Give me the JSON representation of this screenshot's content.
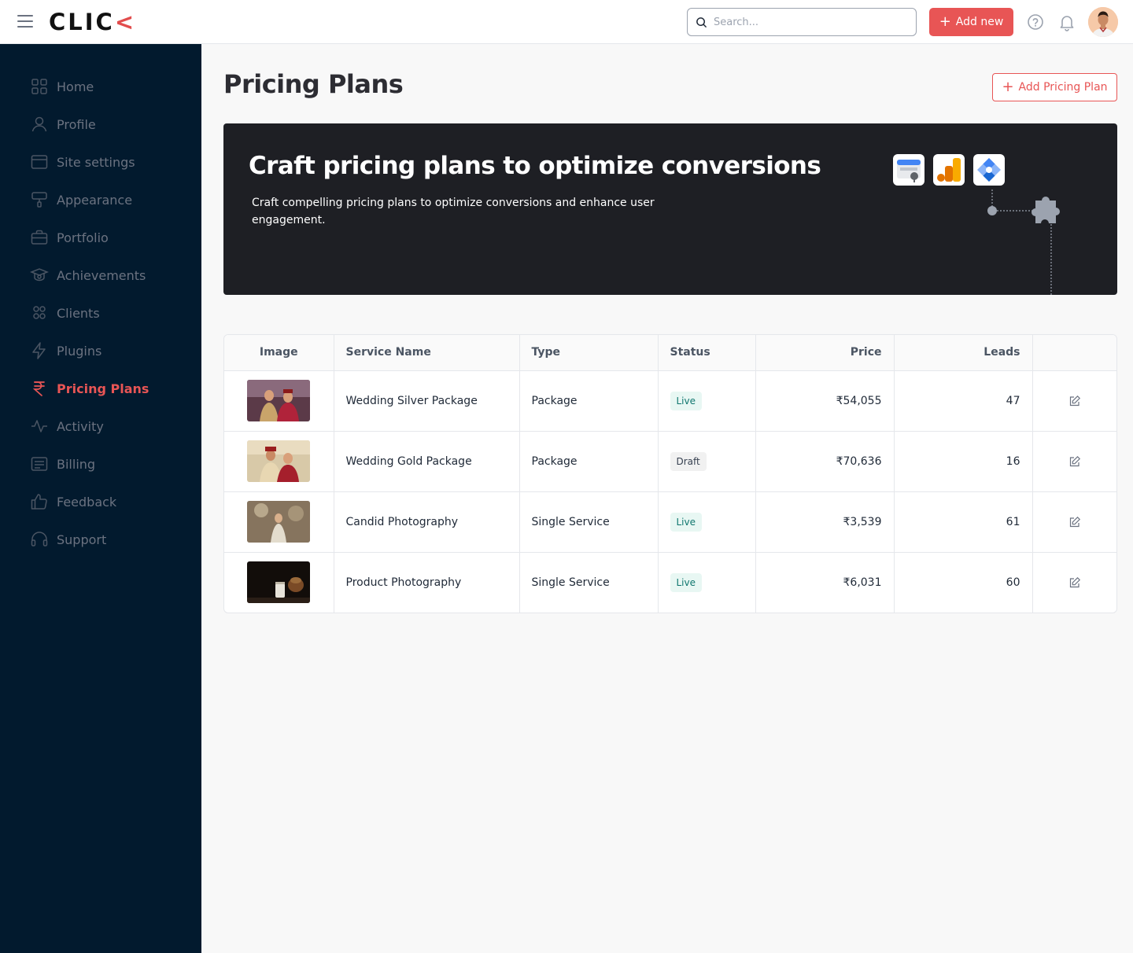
{
  "header": {
    "logo_main": "CLIC",
    "logo_accent": "<",
    "search_placeholder": "Search...",
    "add_new_label": "Add new"
  },
  "sidebar": {
    "items": [
      {
        "label": "Home",
        "icon": "grid-icon"
      },
      {
        "label": "Profile",
        "icon": "user-icon"
      },
      {
        "label": "Site settings",
        "icon": "browser-icon"
      },
      {
        "label": "Appearance",
        "icon": "paint-roller-icon"
      },
      {
        "label": "Portfolio",
        "icon": "briefcase-icon"
      },
      {
        "label": "Achievements",
        "icon": "award-icon"
      },
      {
        "label": "Clients",
        "icon": "users-icon"
      },
      {
        "label": "Plugins",
        "icon": "lightning-icon"
      },
      {
        "label": "Pricing Plans",
        "icon": "rupee-icon",
        "active": true
      },
      {
        "label": "Activity",
        "icon": "activity-icon"
      },
      {
        "label": "Billing",
        "icon": "receipt-icon"
      },
      {
        "label": "Feedback",
        "icon": "thumbs-up-icon"
      },
      {
        "label": "Support",
        "icon": "headset-icon"
      }
    ]
  },
  "main": {
    "title": "Pricing Plans",
    "add_plan_label": "Add Pricing Plan",
    "banner": {
      "title": "Craft pricing plans to optimize conversions",
      "subtitle": "Craft compelling pricing plans to optimize conversions and enhance user engagement."
    },
    "table": {
      "columns": [
        "Image",
        "Service Name",
        "Type",
        "Status",
        "Price",
        "Leads",
        ""
      ],
      "rows": [
        {
          "name": "Wedding Silver Package",
          "type": "Package",
          "status": "Live",
          "price": "₹54,055",
          "leads": "47"
        },
        {
          "name": "Wedding Gold Package",
          "type": "Package",
          "status": "Draft",
          "price": "₹70,636",
          "leads": "16"
        },
        {
          "name": "Candid Photography",
          "type": "Single Service",
          "status": "Live",
          "price": "₹3,539",
          "leads": "61"
        },
        {
          "name": "Product Photography",
          "type": "Single Service",
          "status": "Live",
          "price": "₹6,031",
          "leads": "60"
        }
      ]
    }
  },
  "colors": {
    "accent": "#e85555",
    "sidebar_bg": "#021a2e",
    "banner_bg": "#1e1f24",
    "live_bg": "#e8f7f3",
    "live_text": "#0f766e"
  }
}
